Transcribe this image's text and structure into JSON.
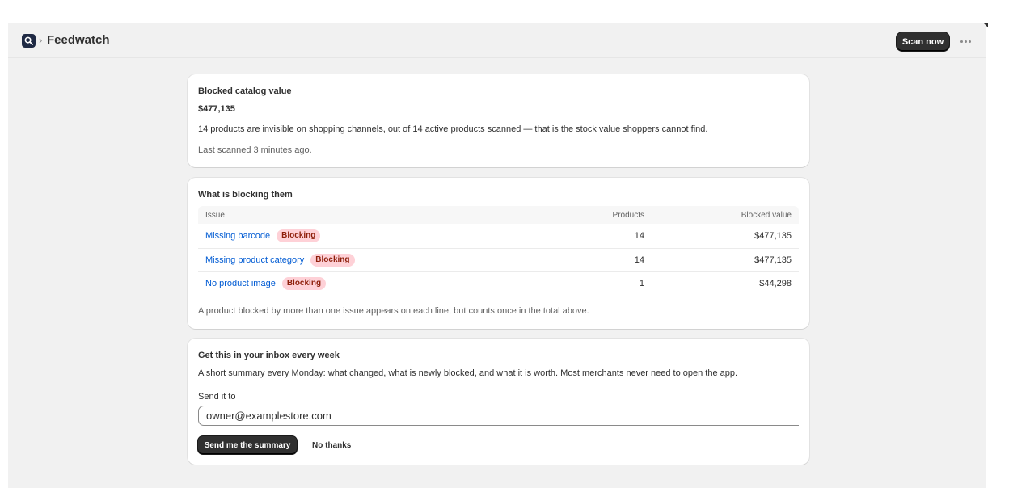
{
  "header": {
    "app_icon": "magnifier-icon",
    "breadcrumb_separator": "›",
    "app_title": "Feedwatch",
    "scan_button": "Scan now",
    "more_icon": "ellipsis-icon"
  },
  "summary": {
    "title": "Blocked catalog value",
    "value": "$477,135",
    "description": "14 products are invisible on shopping channels, out of 14 active products scanned — that is the stock value shoppers cannot find.",
    "last_scanned": "Last scanned 3 minutes ago."
  },
  "blocking": {
    "title": "What is blocking them",
    "columns": {
      "issue": "Issue",
      "products": "Products",
      "value": "Blocked value"
    },
    "rows": [
      {
        "issue": "Missing barcode",
        "badge": "Blocking",
        "products": "14",
        "value": "$477,135"
      },
      {
        "issue": "Missing product category",
        "badge": "Blocking",
        "products": "14",
        "value": "$477,135"
      },
      {
        "issue": "No product image",
        "badge": "Blocking",
        "products": "1",
        "value": "$44,298"
      }
    ],
    "footnote": "A product blocked by more than one issue appears on each line, but counts once in the total above."
  },
  "inbox": {
    "title": "Get this in your inbox every week",
    "description": "A short summary every Monday: what changed, what is newly blocked, and what it is worth. Most merchants never need to open the app.",
    "field_label": "Send it to",
    "email_value": "owner@examplestore.com",
    "send_button": "Send me the summary",
    "decline_button": "No thanks"
  },
  "colors": {
    "primary_button": "#303030",
    "link": "#005bd3",
    "badge_bg": "#fed1d7",
    "badge_text": "#8e1f0b",
    "page_bg": "#f1f1f1"
  }
}
